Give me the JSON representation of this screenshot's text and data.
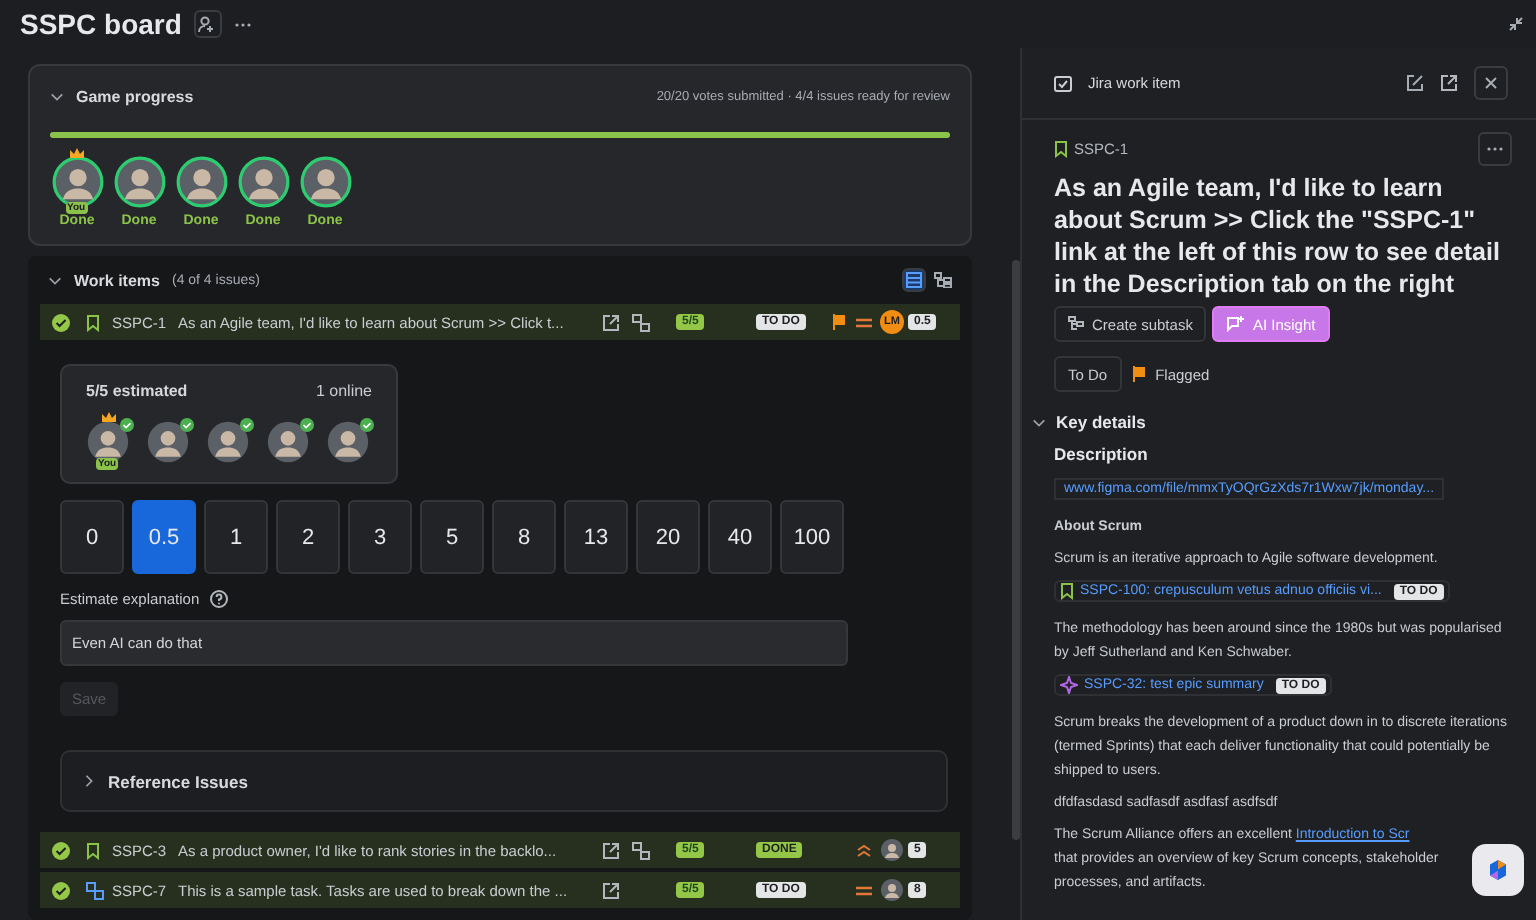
{
  "board": {
    "title": "SSPC board"
  },
  "game_progress": {
    "title": "Game progress",
    "summary": "20/20 votes submitted · 4/4 issues ready for review",
    "expanded": true,
    "level": 1,
    "players": [
      {
        "status": "Done",
        "host": true,
        "tag": "You"
      },
      {
        "status": "Done",
        "host": false
      },
      {
        "status": "Done",
        "host": false
      },
      {
        "status": "Done",
        "host": false
      },
      {
        "status": "Done",
        "host": false
      }
    ]
  },
  "work_items": {
    "title": "Work items",
    "count": "(4 of 4 issues)",
    "expanded": true,
    "rows": [
      {
        "key": "SSPC-1",
        "kind": "story",
        "summary": "As an Agile team, I'd like to learn about Scrum >> Click t...",
        "linked": true,
        "votes": "5/5",
        "status": {
          "text": "TO DO",
          "kind": "todo"
        },
        "flagged": true,
        "priority": {
          "kind": "medium"
        },
        "assignee": {
          "kind": "initials",
          "text": "LM"
        },
        "estimate": "0.5",
        "done": true,
        "detail": {
          "estimated": "5/5 estimated",
          "online": "1 online",
          "voters": [
            {
              "voted": true,
              "host": true,
              "tag": "You"
            },
            {
              "voted": true,
              "host": false
            },
            {
              "voted": true,
              "host": false
            },
            {
              "voted": true,
              "host": false
            },
            {
              "voted": true,
              "host": false
            }
          ],
          "cards": [
            {
              "label": "0",
              "selected": false
            },
            {
              "label": "0.5",
              "selected": true
            },
            {
              "label": "1",
              "selected": false
            },
            {
              "label": "2",
              "selected": false
            },
            {
              "label": "3",
              "selected": false
            },
            {
              "label": "5",
              "selected": false
            },
            {
              "label": "8",
              "selected": false
            },
            {
              "label": "13",
              "selected": false
            },
            {
              "label": "20",
              "selected": false
            },
            {
              "label": "40",
              "selected": false
            },
            {
              "label": "100",
              "selected": false
            }
          ],
          "explanation_label": "Estimate explanation",
          "explanation": "Even AI can do that",
          "save": {
            "label": "Save",
            "disabled": true
          },
          "reference": {
            "title": "Reference Issues",
            "expanded": false
          }
        }
      },
      {
        "key": "SSPC-3",
        "kind": "story",
        "summary": "As a product owner, I'd like to rank stories in the backlo...",
        "linked": true,
        "votes": "5/5",
        "status": {
          "text": "DONE",
          "kind": "done"
        },
        "flagged": false,
        "priority": {
          "kind": "high"
        },
        "assignee": {
          "kind": "avatar"
        },
        "estimate": "5",
        "done": true
      },
      {
        "key": "SSPC-7",
        "kind": "task",
        "summary": "This is a sample task. Tasks are used to break down the ...",
        "linked": false,
        "votes": "5/5",
        "status": {
          "text": "TO DO",
          "kind": "todo"
        },
        "flagged": false,
        "priority": {
          "kind": "medium"
        },
        "assignee": {
          "kind": "avatar"
        },
        "estimate": "8",
        "done": true
      }
    ]
  },
  "work_item_panel": {
    "title": "Jira work item",
    "key": "SSPC-1",
    "kind": "story",
    "summary": "As an Agile team, I'd like to learn about Scrum >> Click the \"SSPC-1\" link at the left of this row to see detail in the Description tab on the right",
    "actions": [
      {
        "kind": "subtask",
        "label": "Create subtask"
      },
      {
        "kind": "ai",
        "label": "AI Insight"
      }
    ],
    "status": "To Do",
    "flag": "Flagged",
    "key_details": {
      "title": "Key details",
      "expanded": true,
      "description_label": "Description",
      "blocks": [
        {
          "kind": "link_box",
          "text": "www.figma.com/file/mmxTyOQrGzXds7r1Wxw7jk/monday..."
        },
        {
          "kind": "heading",
          "text": "About Scrum"
        },
        {
          "kind": "paragraph",
          "text": "Scrum is an iterative approach to  Agile software development."
        },
        {
          "kind": "story_issue",
          "text": "SSPC-100: crepusculum vetus adnuo officiis vi...",
          "status": "TO DO"
        },
        {
          "kind": "paragraph",
          "text": "The methodology has been around since the 1980s but was popularised by Jeff Sutherland and Ken Schwaber."
        },
        {
          "kind": "epic_issue",
          "text": "SSPC-32: test epic summary",
          "status": "TO DO"
        },
        {
          "kind": "paragraph",
          "text": "Scrum breaks the development of a product down in to discrete iterations (termed Sprints) that each deliver functionality that could potentially be shipped to users."
        },
        {
          "kind": "paragraph",
          "text": "dfdfasdasd sadfasdf asdfasf asdfsdf"
        },
        {
          "kind": "link_paragraph",
          "before": "The Scrum Alliance offers an excellent",
          "link": "Introduction to Scr",
          "after": "that provides an overview of key Scrum concepts, stakeholder",
          "end": "processes, and artifacts."
        }
      ]
    }
  }
}
